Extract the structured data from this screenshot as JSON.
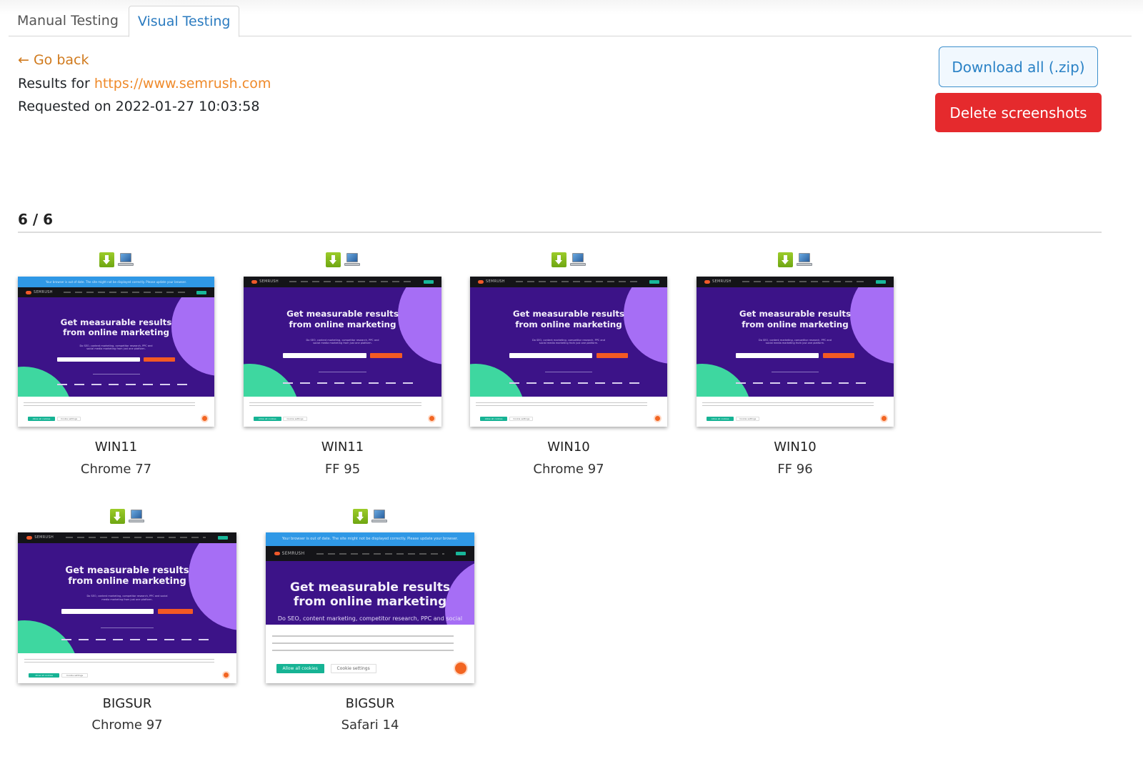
{
  "tabs": [
    {
      "label": "Manual Testing",
      "active": false
    },
    {
      "label": "Visual Testing",
      "active": true
    }
  ],
  "header": {
    "go_back": "← Go back",
    "results_prefix": "Results for ",
    "results_url": "https://www.semrush.com",
    "requested_label": "Requested on 2022-01-27 10:03:58"
  },
  "actions": {
    "download_all": "Download all (.zip)",
    "delete_screenshots": "Delete screenshots"
  },
  "results_count": "6 / 6",
  "colors": {
    "active_tab": "#2b7bc0",
    "go_back": "#d07a1d",
    "link": "#ef8a2a",
    "download_border": "#3d8fcc",
    "delete_bg": "#e52a2d",
    "download_icon": "#7db51a",
    "thumb_hero": "#3c1388",
    "thumb_blob_purple": "#a66ef5",
    "thumb_blob_green": "#3ed7a0"
  },
  "thumbnail_content": {
    "outdated_banner": "Your browser is out of date. The site might not be displayed correctly. Please update your browser.",
    "brand": "SEMRUSH",
    "headline_line1": "Get measurable results",
    "headline_line2": "from online marketing",
    "subtitle": "Do SEO, content marketing, competitor research, PPC and social media marketing from just one platform.",
    "subtitle_mobile": "Do SEO, content marketing, competitor research, PPC and social",
    "allow_cookies": "Allow all cookies",
    "cookie_settings": "Cookie settings"
  },
  "screenshots": [
    {
      "os": "WIN11",
      "browser": "Chrome 77",
      "outdated_banner": true,
      "icons": [
        "download-icon",
        "computer-icon"
      ]
    },
    {
      "os": "WIN11",
      "browser": "FF 95",
      "outdated_banner": false,
      "icons": [
        "download-icon",
        "computer-icon"
      ]
    },
    {
      "os": "WIN10",
      "browser": "Chrome 97",
      "outdated_banner": false,
      "icons": [
        "download-icon",
        "computer-icon"
      ]
    },
    {
      "os": "WIN10",
      "browser": "FF 96",
      "outdated_banner": false,
      "icons": [
        "download-icon",
        "computer-icon"
      ]
    },
    {
      "os": "BIGSUR",
      "browser": "Chrome 97",
      "outdated_banner": false,
      "icons": [
        "download-icon",
        "computer-icon"
      ]
    },
    {
      "os": "BIGSUR",
      "browser": "Safari 14",
      "outdated_banner": true,
      "icons": [
        "download-icon",
        "computer-icon"
      ]
    }
  ]
}
